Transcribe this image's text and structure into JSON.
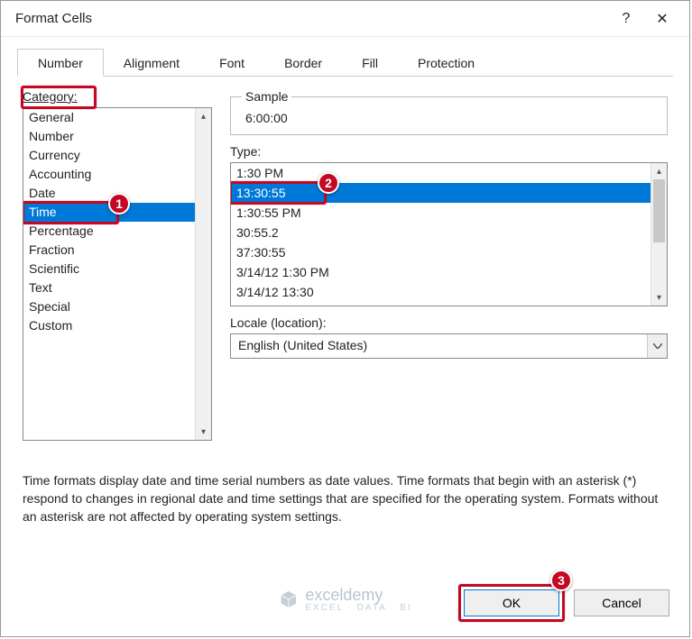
{
  "window": {
    "title": "Format Cells",
    "help_symbol": "?",
    "close_symbol": "✕"
  },
  "tabs": [
    {
      "label": "Number",
      "active": true
    },
    {
      "label": "Alignment",
      "active": false
    },
    {
      "label": "Font",
      "active": false
    },
    {
      "label": "Border",
      "active": false
    },
    {
      "label": "Fill",
      "active": false
    },
    {
      "label": "Protection",
      "active": false
    }
  ],
  "category": {
    "label": "Category:",
    "items": [
      "General",
      "Number",
      "Currency",
      "Accounting",
      "Date",
      "Time",
      "Percentage",
      "Fraction",
      "Scientific",
      "Text",
      "Special",
      "Custom"
    ],
    "selected_index": 5
  },
  "sample": {
    "legend": "Sample",
    "value": "6:00:00"
  },
  "type": {
    "label": "Type:",
    "items": [
      "1:30 PM",
      "13:30:55",
      "1:30:55 PM",
      "30:55.2",
      "37:30:55",
      "3/14/12 1:30 PM",
      "3/14/12 13:30"
    ],
    "selected_index": 1
  },
  "locale": {
    "label": "Locale (location):",
    "value": "English (United States)"
  },
  "description": "Time formats display date and time serial numbers as date values.  Time formats that begin with an asterisk (*) respond to changes in regional date and time settings that are specified for the operating system. Formats without an asterisk are not affected by operating system settings.",
  "buttons": {
    "ok": "OK",
    "cancel": "Cancel"
  },
  "callouts": {
    "one": "1",
    "two": "2",
    "three": "3"
  },
  "watermark": {
    "brand": "exceldemy",
    "tagline": "EXCEL · DATA · BI"
  }
}
